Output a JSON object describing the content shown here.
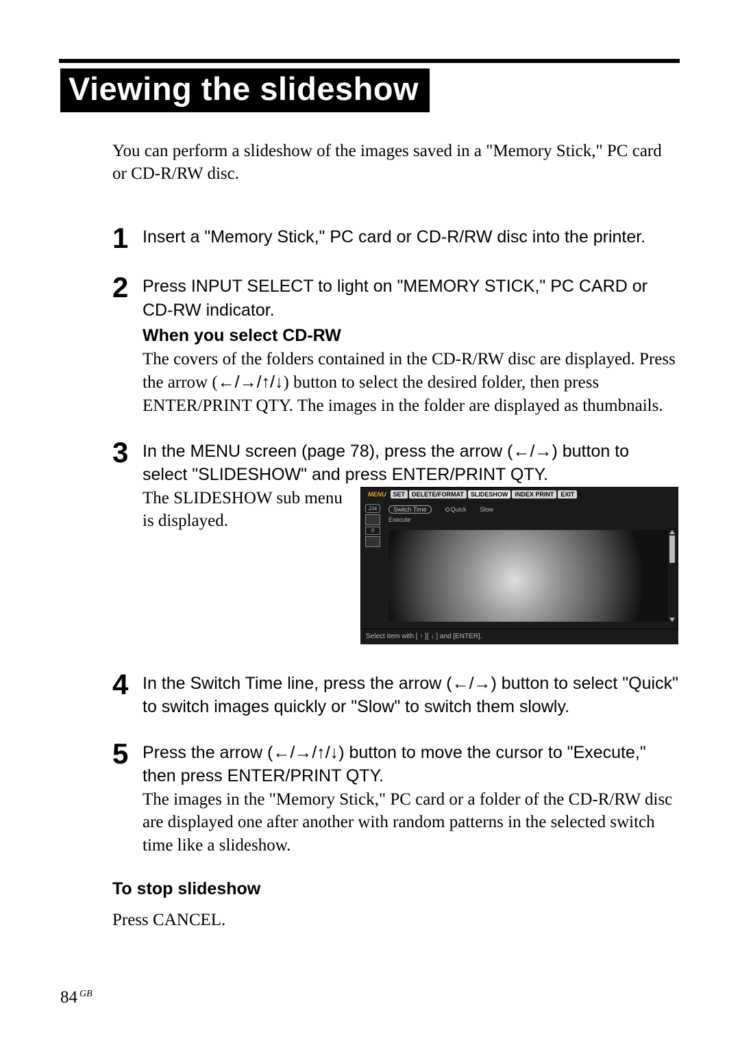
{
  "title": "Viewing the slideshow",
  "intro": "You can perform a slideshow of the images saved in a \"Memory Stick,\" PC card or CD-R/RW disc.",
  "steps": {
    "s1": {
      "lead": "Insert a \"Memory Stick,\" PC card or CD-R/RW disc into the printer."
    },
    "s2": {
      "lead": "Press INPUT SELECT to light on \"MEMORY STICK,\" PC CARD or CD-RW indicator.",
      "sub_bold": "When you select CD-RW",
      "serif_pre": "The covers of the folders contained in the CD-R/RW disc are displayed. Press the arrow (",
      "serif_arrows": "←/→/↑/↓",
      "serif_post": ") button to select the desired folder, then press ENTER/PRINT QTY. The images in the folder are displayed as thumbnails."
    },
    "s3": {
      "lead_pre": "In the MENU screen (page 78), press the arrow (",
      "lead_arrows": "←/→",
      "lead_post": ") button to select \"SLIDESHOW\" and press ENTER/PRINT QTY.",
      "serif": "The SLIDESHOW sub menu is displayed."
    },
    "s4": {
      "lead_pre": "In the Switch Time line, press the arrow (",
      "lead_arrows": "←/→",
      "lead_post": ") button to select \"Quick\" to switch images quickly or \"Slow\" to switch them slowly."
    },
    "s5": {
      "lead_pre": "Press the arrow (",
      "lead_arrows": "←/→/↑/↓",
      "lead_post": ") button to move the cursor to \"Execute,\" then press ENTER/PRINT QTY.",
      "serif": "The images in the \"Memory Stick,\" PC card or a folder of the CD-R/RW disc are displayed one after another with random patterns in the selected switch time like a slideshow."
    }
  },
  "stop": {
    "head": "To stop slideshow",
    "body": "Press CANCEL."
  },
  "menu_screenshot": {
    "tabs": {
      "menu": "MENU",
      "set": "SET",
      "delete": "DELETE/FORMAT",
      "slideshow": "SLIDESHOW",
      "index": "INDEX PRINT",
      "exit": "EXIT"
    },
    "count": "234",
    "zero": "0",
    "switch_label": "Switch Time",
    "quick": "Quick",
    "slow": "Slow",
    "execute": "Execute",
    "caption": "Select item with [ ↑ ][ ↓ ] and [ENTER]."
  },
  "page": {
    "num": "84",
    "gb": "GB"
  }
}
